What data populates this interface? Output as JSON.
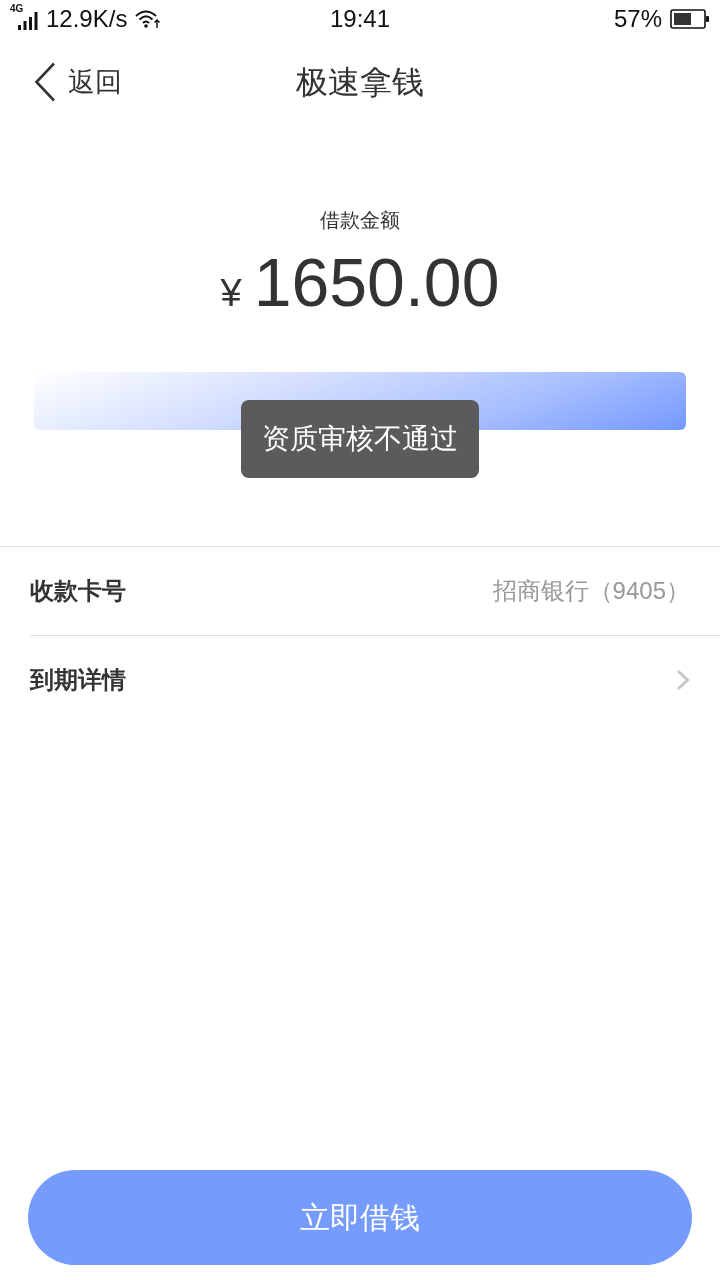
{
  "status_bar": {
    "network": "4G",
    "speed": "12.9K/s",
    "time": "19:41",
    "battery": "57%"
  },
  "nav": {
    "back": "返回",
    "title": "极速拿钱"
  },
  "amount": {
    "label": "借款金额",
    "currency": "¥",
    "value": "1650.00"
  },
  "toast": {
    "text": "资质审核不通过"
  },
  "rows": [
    {
      "kind": "value",
      "label": "收款卡号",
      "value": "招商银行（9405）"
    },
    {
      "kind": "link",
      "label": "到期详情"
    }
  ],
  "primary_button": {
    "label": "立即借钱"
  }
}
